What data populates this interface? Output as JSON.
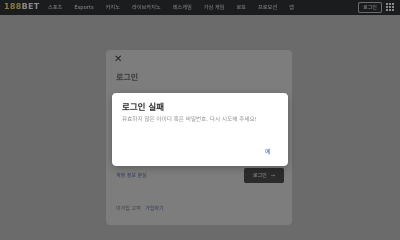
{
  "header": {
    "logo_num": "188",
    "logo_bet": "BET",
    "nav": [
      "스포츠",
      "Esports",
      "카지노",
      "라이브카지노",
      "레스게임",
      "가상 게임",
      "로또",
      "프로모션",
      "앱"
    ],
    "login_label": "로그인"
  },
  "login_panel": {
    "title": "로그인",
    "forgot_label": "계정 정보 분실",
    "login_button_label": "로그인",
    "no_account_label": "미가입 고객",
    "signup_label": "가입하기"
  },
  "modal": {
    "title": "로그인 실패",
    "message": "유효하지 않은 아이디 혹은 비밀번호. 다시 시도해 주세요!",
    "ok_label": "예"
  }
}
